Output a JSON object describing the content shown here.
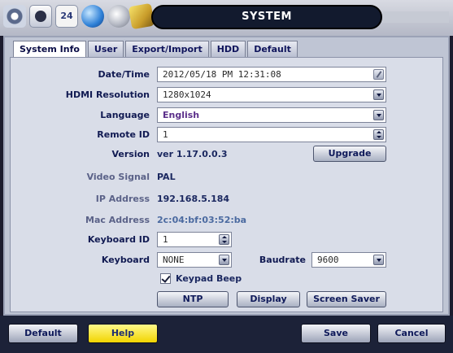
{
  "header": {
    "title": "SYSTEM",
    "schedule_icon_text": "24",
    "icons": [
      "settings-icon",
      "record-icon",
      "schedule-icon",
      "network-icon",
      "device-icon",
      "tools-icon"
    ]
  },
  "tabs": [
    {
      "label": "System Info",
      "active": true
    },
    {
      "label": "User"
    },
    {
      "label": "Export/Import"
    },
    {
      "label": "HDD"
    },
    {
      "label": "Default"
    }
  ],
  "form": {
    "datetime_label": "Date/Time",
    "datetime_value": "2012/05/18 PM 12:31:08",
    "hdmi_label": "HDMI Resolution",
    "hdmi_value": "1280x1024",
    "language_label": "Language",
    "language_value": "English",
    "remote_label": "Remote ID",
    "remote_value": "1",
    "version_label": "Version",
    "version_value": "ver 1.17.0.0.3",
    "upgrade_label": "Upgrade",
    "video_signal_label": "Video Signal",
    "video_signal_value": "PAL",
    "ip_label": "IP Address",
    "ip_value": "192.168.5.184",
    "mac_label": "Mac Address",
    "mac_value": "2c:04:bf:03:52:ba",
    "keyboard_id_label": "Keyboard ID",
    "keyboard_id_value": "1",
    "keyboard_label": "Keyboard",
    "keyboard_value": "NONE",
    "baudrate_label": "Baudrate",
    "baudrate_value": "9600",
    "keypad_beep_label": "Keypad Beep",
    "keypad_beep_checked": true,
    "ntp_label": "NTP",
    "display_label": "Display",
    "screen_saver_label": "Screen Saver"
  },
  "footer": {
    "default_label": "Default",
    "help_label": "Help",
    "save_label": "Save",
    "cancel_label": "Cancel"
  },
  "colors": {
    "help_button": "#f1d400",
    "title_bar": "#121a2e"
  }
}
